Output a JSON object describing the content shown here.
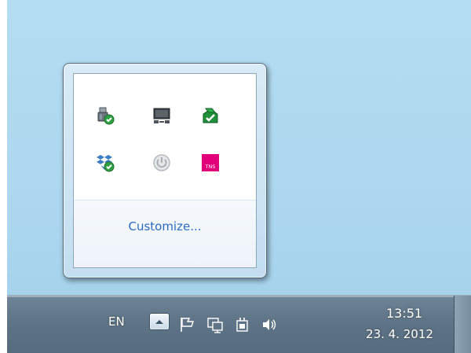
{
  "popup": {
    "customize_label": "Customize...",
    "icons": [
      {
        "name": "safely-remove-hardware-icon"
      },
      {
        "name": "network-display-icon"
      },
      {
        "name": "green-shield-check-icon"
      },
      {
        "name": "dropbox-icon"
      },
      {
        "name": "power-icon"
      },
      {
        "name": "tns-icon",
        "label": "TNS"
      }
    ]
  },
  "taskbar": {
    "language": "EN",
    "clock_time": "13:51",
    "clock_date": "23. 4. 2012"
  },
  "colors": {
    "desktop": "#b4dcf2",
    "taskbar": "#5f7587",
    "link": "#2a6bc0",
    "tns_brand": "#e2007a",
    "check_green": "#2ea043"
  }
}
